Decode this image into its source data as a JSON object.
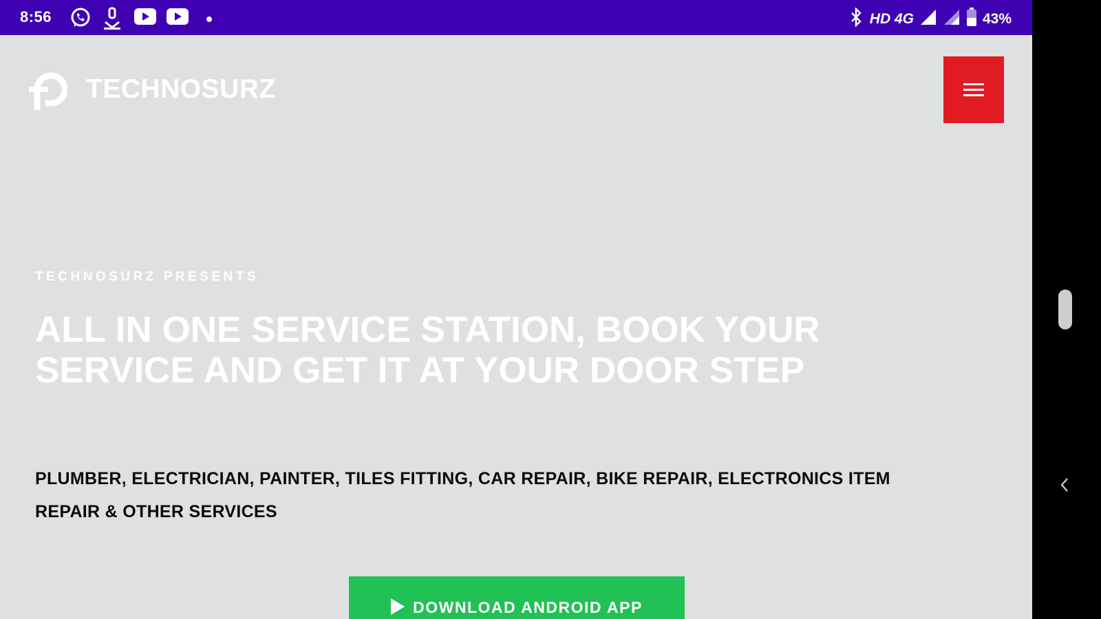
{
  "status_bar": {
    "time": "8:56",
    "left_icons": [
      "whatsapp-icon",
      "download-icon",
      "youtube-icon",
      "youtube-icon",
      "dot-icon"
    ],
    "right_text": "HD 4G",
    "battery": "43%",
    "right_icons": [
      "bluetooth-icon",
      "signal-icon",
      "signal-icon",
      "battery-icon"
    ]
  },
  "header": {
    "brand": "TECHNOSURZ",
    "menu_icon": "hamburger-icon"
  },
  "hero": {
    "eyebrow": "TECHNOSURZ PRESENTS",
    "headline": "ALL IN ONE SERVICE STATION, BOOK YOUR SERVICE AND GET IT AT YOUR DOOR STEP",
    "services": "PLUMBER, ELECTRICIAN, PAINTER, TILES FITTING, CAR REPAIR, BIKE REPAIR, ELECTRONICS ITEM REPAIR & OTHER SERVICES",
    "cta_label": "DOWNLOAD ANDROID APP"
  },
  "colors": {
    "status_bar": "#3e02b3",
    "page_bg": "#dfe0e2",
    "menu_button": "#e11b22",
    "cta": "#22c155"
  }
}
